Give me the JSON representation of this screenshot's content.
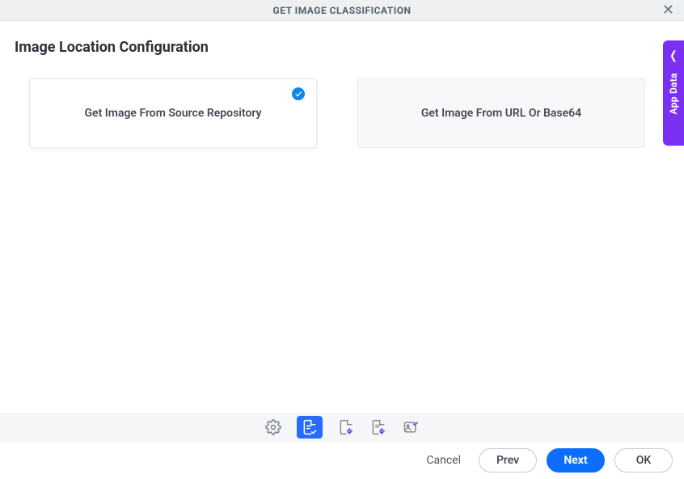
{
  "header": {
    "title": "GET IMAGE CLASSIFICATION"
  },
  "page_title": "Image Location Configuration",
  "cards": [
    {
      "label": "Get Image From Source Repository",
      "selected": true
    },
    {
      "label": "Get Image From URL Or Base64",
      "selected": false
    }
  ],
  "side_tab": {
    "label": "App Data"
  },
  "steps": [
    {
      "name": "gear-icon",
      "active": false
    },
    {
      "name": "document-check-icon",
      "active": true
    },
    {
      "name": "document-gear-icon",
      "active": false
    },
    {
      "name": "document-cog-icon",
      "active": false
    },
    {
      "name": "image-check-icon",
      "active": false
    }
  ],
  "footer": {
    "cancel": "Cancel",
    "prev": "Prev",
    "next": "Next",
    "ok": "OK"
  }
}
